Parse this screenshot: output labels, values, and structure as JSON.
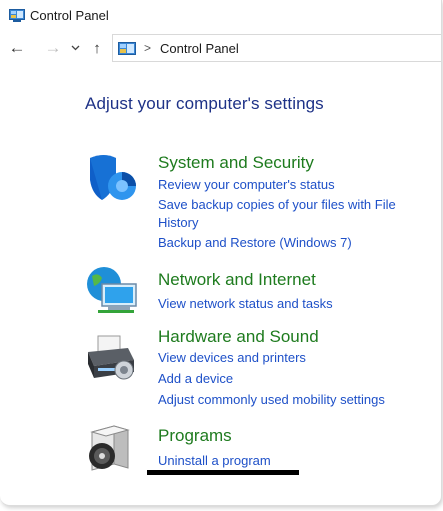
{
  "window": {
    "title": "Control Panel"
  },
  "nav": {
    "back_label": "←",
    "forward_label": "→",
    "recent_label": "⌄",
    "up_label": "↑",
    "address_separator": ">",
    "address_text": "Control Panel"
  },
  "content": {
    "heading": "Adjust your computer's settings",
    "categories": [
      {
        "title": "System and Security",
        "icon": "shield-icon",
        "links": [
          "Review your computer's status",
          "Save backup copies of your files with File",
          "History",
          "Backup and Restore (Windows 7)"
        ]
      },
      {
        "title": "Network and Internet",
        "icon": "network-globe-icon",
        "links": [
          "View network status and tasks"
        ]
      },
      {
        "title": "Hardware and Sound",
        "icon": "printer-icon",
        "links": [
          "View devices and printers",
          "Add a device",
          "Adjust commonly used mobility settings"
        ]
      },
      {
        "title": "Programs",
        "icon": "programs-disc-icon",
        "links": [
          "Uninstall a program"
        ]
      }
    ]
  },
  "colors": {
    "heading": "#1e3287",
    "category_title": "#1e7b1e",
    "link": "#1e50c8"
  }
}
